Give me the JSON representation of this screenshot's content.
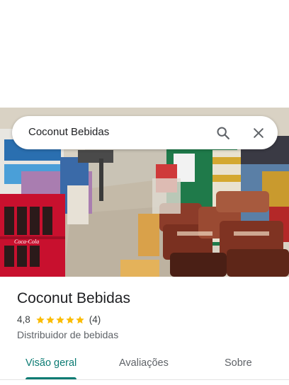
{
  "search": {
    "query": "Coconut Bebidas"
  },
  "place": {
    "name": "Coconut Bebidas",
    "rating": "4,8",
    "stars": 5,
    "reviews_count": "(4)",
    "category": "Distribuidor de bebidas"
  },
  "tabs": [
    {
      "label": "Visão geral",
      "active": true
    },
    {
      "label": "Avaliações",
      "active": false
    },
    {
      "label": "Sobre",
      "active": false
    }
  ],
  "photo": {
    "crate_brand": "Coca-Cola"
  },
  "colors": {
    "accent": "#0b7b73",
    "star": "#fbbc04",
    "text": "#202124",
    "muted": "#5f6368"
  },
  "icons": [
    "search-icon",
    "close-icon",
    "star-icon"
  ]
}
